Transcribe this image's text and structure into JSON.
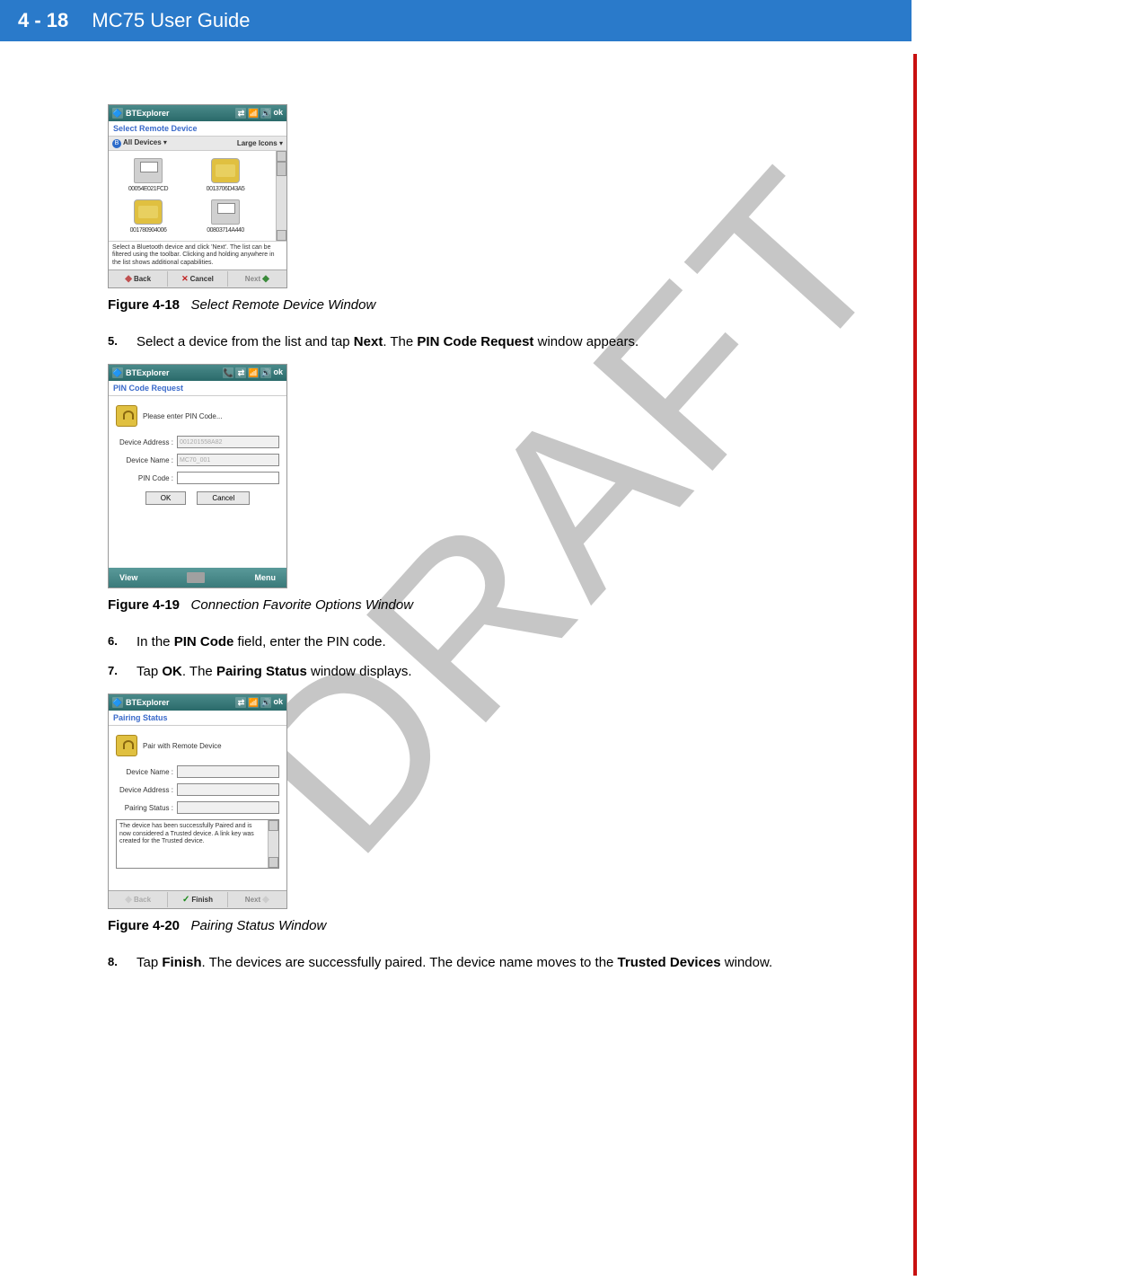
{
  "header": {
    "page": "4 - 18",
    "title": "MC75 User Guide"
  },
  "watermark": "DRAFT",
  "screenshot1": {
    "title": "BTExplorer",
    "ok": "ok",
    "subtitle": "Select Remote Device",
    "toolbar_left": "All Devices",
    "toolbar_right": "Large Icons",
    "devices": [
      {
        "label": "00054E021FCD"
      },
      {
        "label": "0013706D43A5"
      },
      {
        "label": "001780904006"
      },
      {
        "label": "00803714A440"
      }
    ],
    "info": "Select a Bluetooth device and click 'Next'. The list can be filtered using the toolbar. Clicking and holding anywhere in the list shows additional capabilities.",
    "btn_back": "Back",
    "btn_cancel": "Cancel",
    "btn_next": "Next"
  },
  "caption1": {
    "label": "Figure 4-18",
    "text": "Select Remote Device Window"
  },
  "step5": {
    "num": "5.",
    "pre": "Select a device from the list and tap ",
    "b1": "Next",
    "mid": ". The ",
    "b2": "PIN Code Request",
    "post": " window appears."
  },
  "screenshot2": {
    "title": "BTExplorer",
    "ok": "ok",
    "subtitle": "PIN Code Request",
    "header_text": "Please enter PIN Code...",
    "field1_label": "Device Address :",
    "field1_value": "001201558A82",
    "field2_label": "Device Name :",
    "field2_value": "MC70_001",
    "field3_label": "PIN Code :",
    "btn_ok": "OK",
    "btn_cancel": "Cancel",
    "footer_left": "View",
    "footer_right": "Menu"
  },
  "caption2": {
    "label": "Figure 4-19",
    "text": "Connection Favorite Options Window"
  },
  "step6": {
    "num": "6.",
    "pre": "In the ",
    "b1": "PIN Code",
    "post": " field, enter the PIN code."
  },
  "step7": {
    "num": "7.",
    "pre": "Tap ",
    "b1": "OK",
    "mid": ". The ",
    "b2": "Pairing Status",
    "post": " window displays."
  },
  "screenshot3": {
    "title": "BTExplorer",
    "ok": "ok",
    "subtitle": "Pairing Status",
    "header_text": "Pair with Remote Device",
    "field1_label": "Device Name :",
    "field1_value": "",
    "field2_label": "Device Address :",
    "field2_value": "",
    "field3_label": "Pairing Status :",
    "field3_value": "",
    "info": "The device has been successfully Paired and is now considered a Trusted device.  A link key was created for the Trusted device.",
    "btn_back": "Back",
    "btn_finish": "Finish",
    "btn_next": "Next"
  },
  "caption3": {
    "label": "Figure 4-20",
    "text": "Pairing Status Window"
  },
  "step8": {
    "num": "8.",
    "pre": "Tap ",
    "b1": "Finish",
    "mid": ". The devices are successfully paired. The device name moves to the ",
    "b2": "Trusted Devices",
    "post": " window."
  }
}
